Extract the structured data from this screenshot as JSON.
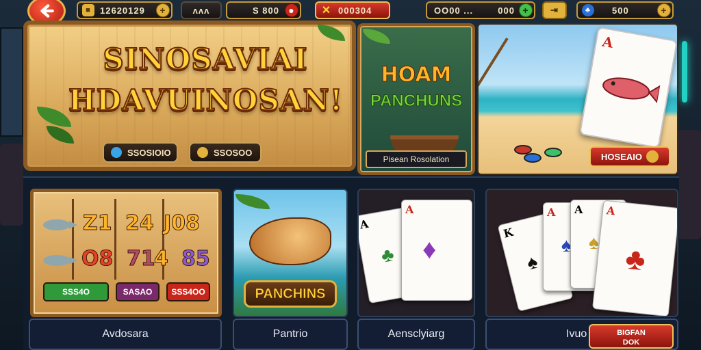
{
  "topbar": {
    "coins": "12620129",
    "name": "ᴧᴧᴧ",
    "gems": "S 800",
    "bonus": "000304",
    "search": "OO00 ...",
    "balance": "000",
    "tickets": "500"
  },
  "hero": {
    "title_line1": "SINOSAVIAI",
    "title_line2": "HDAVUINOSAN!",
    "pill_left": "SSOSIOIO",
    "pill_right": "SSOSOO"
  },
  "promo_fish": {
    "title_top": "HOAM",
    "title_bottom": "PANCHUNS",
    "caption": "Pisean Rosolation"
  },
  "promo_beach": {
    "card_rank": "A",
    "button": "HOSEAIO"
  },
  "tiles": {
    "slots": {
      "row1": [
        "Z1",
        "24",
        "J08"
      ],
      "row2": [
        "O8",
        "71",
        "4",
        "85"
      ],
      "btn_green": "SSS4O",
      "btn_purple": "SASAO",
      "btn_red": "SSS4OO",
      "label": "Avdosara"
    },
    "panchins": {
      "logo": "PANCHINS",
      "label": "Pantrio"
    },
    "cards": {
      "label": "Aensclyiarg"
    },
    "poker": {
      "label": "Ivuo",
      "join": "BIGFAN\nDOK"
    }
  },
  "colors": {
    "gold": "#e2b23c",
    "red": "#d73a2c",
    "green": "#45c04a",
    "navy": "#131d33"
  }
}
